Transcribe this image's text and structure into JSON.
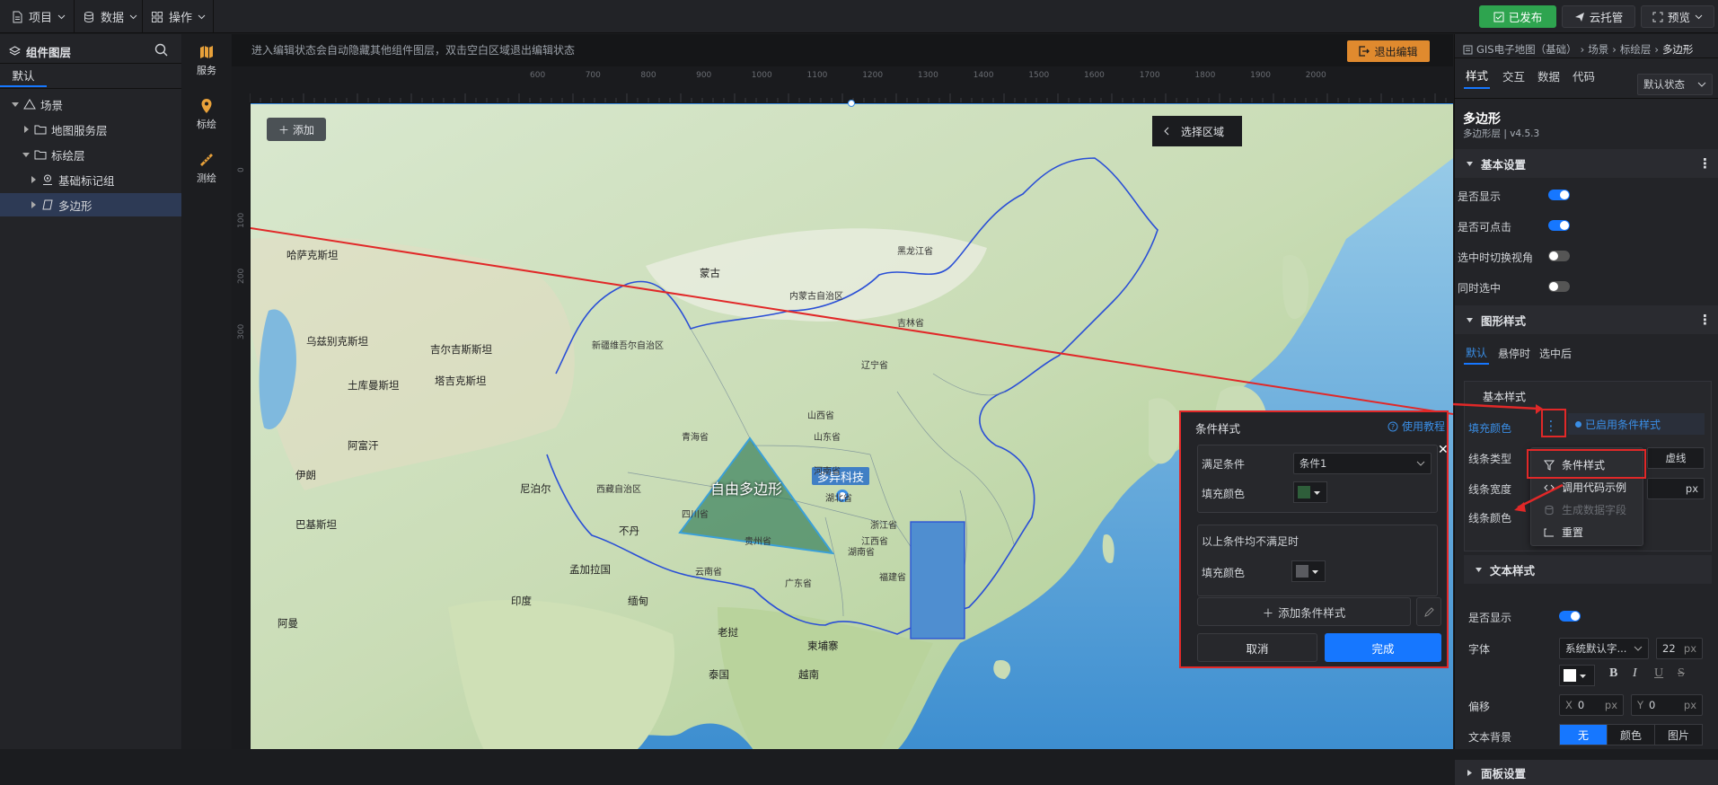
{
  "topbar": {
    "menu": [
      {
        "label": "项目",
        "icon": "file-icon"
      },
      {
        "label": "数据",
        "icon": "database-icon"
      },
      {
        "label": "操作",
        "icon": "grid-icon"
      }
    ],
    "publish": "已发布",
    "cloud": "云托管",
    "preview": "预览"
  },
  "left_panel": {
    "title": "组件图层",
    "tab": "默认",
    "tree": [
      {
        "label": "场景",
        "level": 0
      },
      {
        "label": "地图服务层",
        "level": 1
      },
      {
        "label": "标绘层",
        "level": 1
      },
      {
        "label": "基础标记组",
        "level": 2
      },
      {
        "label": "多边形",
        "level": 2,
        "selected": true
      }
    ]
  },
  "side_tools": [
    {
      "label": "服务",
      "icon": "map-icon"
    },
    {
      "label": "标绘",
      "icon": "marker-icon"
    },
    {
      "label": "测绘",
      "icon": "measure-icon"
    }
  ],
  "canvas": {
    "hint": "进入编辑状态会自动隐藏其他组件图层，双击空白区域退出编辑状态",
    "exit_edit": "退出编辑",
    "add_button": "添加",
    "select_region": "选择区域",
    "ruler_top": [
      "600",
      "700",
      "800",
      "900",
      "1000",
      "1100",
      "1200",
      "1300",
      "1400",
      "1500",
      "1600",
      "1700",
      "1800",
      "1900",
      "2000"
    ],
    "ruler_left": [
      "0",
      "100",
      "200",
      "300"
    ],
    "polygon_label": "自由多边形",
    "marker_label": "多异科技",
    "map_labels": {
      "countries": [
        "哈萨克斯坦",
        "乌兹别克斯坦",
        "吉尔吉斯斯坦",
        "土库曼斯坦",
        "塔吉克斯坦",
        "阿富汗",
        "伊朗",
        "巴基斯坦",
        "印度",
        "阿曼",
        "蒙古",
        "缅甸",
        "老挝",
        "泰国",
        "越南",
        "柬埔寨",
        "孟加拉国",
        "尼泊尔",
        "不丹"
      ],
      "provinces": [
        "新疆维吾尔自治区",
        "西藏自治区",
        "青海省",
        "内蒙古自治区",
        "黑龙江省",
        "吉林省",
        "辽宁省",
        "山西省",
        "山东省",
        "河南省",
        "湖北省",
        "湖南省",
        "江西省",
        "福建省",
        "广东省",
        "云南省",
        "贵州省",
        "四川省",
        "浙江省"
      ]
    }
  },
  "condition_dialog": {
    "title": "条件样式",
    "help": "使用教程",
    "satisfy_label": "满足条件",
    "condition_value": "条件1",
    "fill_label": "填充颜色",
    "fill_color": "#2e5e3a",
    "else_title": "以上条件均不满足时",
    "else_fill_label": "填充颜色",
    "else_fill_color": "#5a5b60",
    "add_condition": "添加条件样式",
    "cancel": "取消",
    "done": "完成"
  },
  "right_panel": {
    "breadcrumb": [
      "GIS电子地图（基础）",
      "场景",
      "标绘层",
      "多边形"
    ],
    "tabs": [
      "样式",
      "交互",
      "数据",
      "代码"
    ],
    "state_select": "默认状态",
    "component_title": "多边形",
    "component_sub": "多边形层 | v4.5.3",
    "basic_settings": "基本设置",
    "toggles": [
      {
        "label": "是否显示",
        "on": true
      },
      {
        "label": "是否可点击",
        "on": true
      },
      {
        "label": "选中时切换视角",
        "on": false
      },
      {
        "label": "同时选中",
        "on": false
      }
    ],
    "shape_style": "图形样式",
    "shape_tabs": [
      "默认",
      "悬停时",
      "选中后"
    ],
    "basic_style": "基本样式",
    "fill_color_label": "填充颜色",
    "cond_enabled": "已启用条件样式",
    "line_type_label": "线条类型",
    "line_type_value": "虚线",
    "line_width_label": "线条宽度",
    "line_width_unit": "px",
    "line_color_label": "线条颜色",
    "text_style": "文本样式",
    "text_show_label": "是否显示",
    "font_label": "字体",
    "font_value": "系统默认字...",
    "font_size": "22",
    "font_unit": "px",
    "offset_label": "偏移",
    "offset_x_label": "X",
    "offset_x": "0",
    "offset_y_label": "Y",
    "offset_y": "0",
    "offset_unit": "px",
    "text_bg_label": "文本背景",
    "text_bg_options": [
      "无",
      "颜色",
      "图片"
    ],
    "panel_settings": "面板设置"
  },
  "context_menu": {
    "items": [
      {
        "label": "条件样式",
        "icon": "filter-icon",
        "disabled": false
      },
      {
        "label": "调用代码示例",
        "icon": "code-icon",
        "disabled": false
      },
      {
        "label": "生成数据字段",
        "icon": "database-icon",
        "disabled": true
      },
      {
        "label": "重置",
        "icon": "reset-icon",
        "disabled": false
      }
    ]
  },
  "colors": {
    "accent": "#1677ff",
    "publish_green": "#2ea44f",
    "exit_orange": "#e08a2e",
    "annotation_red": "#e12828"
  }
}
